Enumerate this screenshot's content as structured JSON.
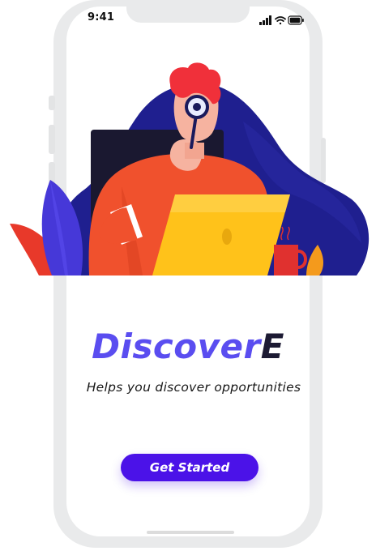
{
  "status_bar": {
    "time": "9:41"
  },
  "hero": {
    "illustration": "person-with-magnifier-and-laptop"
  },
  "app": {
    "title_main": "Discover",
    "title_accent": "E",
    "tagline": "Helps you discover opportunities"
  },
  "cta": {
    "label": "Get Started"
  },
  "colors": {
    "brand": "#5a4df0",
    "button": "#4b12e8",
    "blob": "#1f1f8f",
    "laptop": "#ffc21a",
    "shirt": "#f0512d"
  }
}
